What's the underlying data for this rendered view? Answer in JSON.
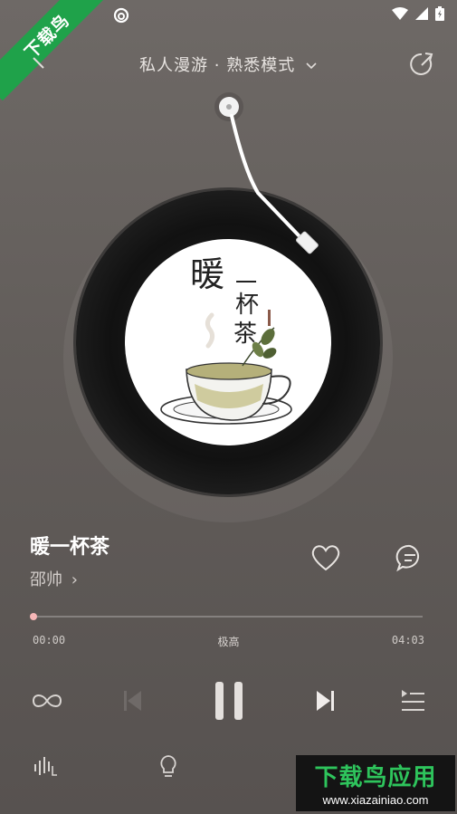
{
  "watermark": {
    "ribbon_text": "下载鸟"
  },
  "header": {
    "title": "私人漫游 · 熟悉模式",
    "mode_chevron": "chevron-down-icon"
  },
  "cover_art": {
    "lines": [
      "暖",
      "一",
      "杯",
      "茶"
    ]
  },
  "song": {
    "title": "暖一杯茶",
    "artist": "邵帅",
    "artist_chevron": "›"
  },
  "playback": {
    "current_time": "00:00",
    "total_time": "04:03",
    "quality": "极高",
    "progress": 0.0
  },
  "controls": [
    "loop-icon",
    "previous-icon",
    "pause-icon",
    "next-icon",
    "playlist-icon"
  ],
  "bottom_bar": [
    "sound-effect-icon",
    "lightbulb-icon"
  ],
  "banner": {
    "brand": "下载鸟应用",
    "url": "www.xiazainiao.com"
  },
  "colors": {
    "accent_progress": "#f2a3a3",
    "brand_green": "#1fa24a"
  }
}
